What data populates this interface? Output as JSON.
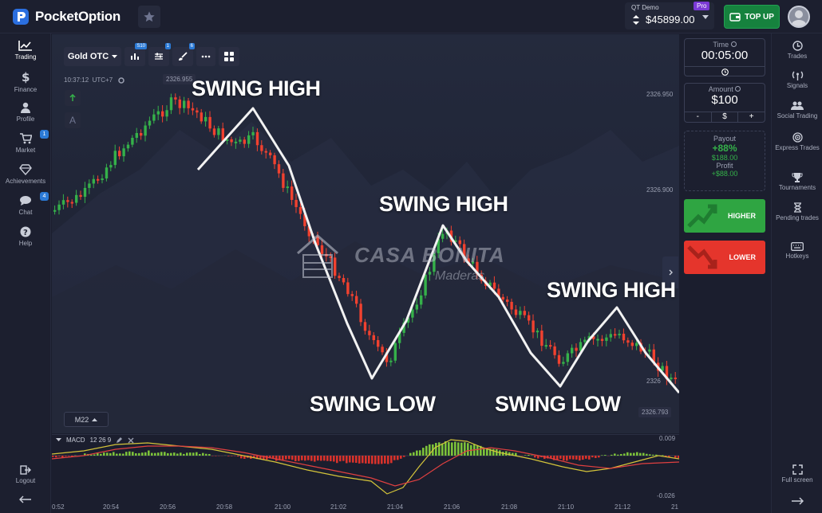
{
  "brand": {
    "name": "PocketOption"
  },
  "account": {
    "mode_label": "QT Demo",
    "pro_badge": "Pro",
    "balance": "$45899.00",
    "topup_label": "TOP UP"
  },
  "left_nav": [
    {
      "label": "Trading",
      "icon": "chart-line-icon"
    },
    {
      "label": "Finance",
      "icon": "dollar-icon"
    },
    {
      "label": "Profile",
      "icon": "user-icon"
    },
    {
      "label": "Market",
      "icon": "cart-icon",
      "badge": "1"
    },
    {
      "label": "Achievements",
      "icon": "diamond-icon"
    },
    {
      "label": "Chat",
      "icon": "chat-icon",
      "badge": "4"
    },
    {
      "label": "Help",
      "icon": "help-icon"
    }
  ],
  "logout_label": "Logout",
  "toolbar": {
    "asset": "Gold OTC",
    "timeframe_badge": "S10",
    "indicators_badge": "1",
    "drawings_badge": "6"
  },
  "chart_info": {
    "time": "10:37:12",
    "timezone": "UTC+7"
  },
  "price_axis": {
    "p1": "2326.950",
    "p2": "2326.900",
    "current_top": "2326.955",
    "current_low": "2326.793",
    "p_partial": "2326"
  },
  "timeframe_select": "M22",
  "annotations": {
    "sh1": "SWING HIGH",
    "sh2": "SWING HIGH",
    "sh3": "SWING HIGH",
    "sl1": "SWING LOW",
    "sl2": "SWING LOW"
  },
  "watermark": {
    "title": "CASA BONITA",
    "subtitle": "Maderas"
  },
  "macd": {
    "label": "MACD",
    "params": "12 26 9",
    "top": "0.009",
    "bottom": "-0.026"
  },
  "x_axis": [
    "0:52",
    "20:54",
    "20:56",
    "20:58",
    "21:00",
    "21:02",
    "21:04",
    "21:06",
    "21:08",
    "21:10",
    "21:12",
    "21"
  ],
  "trade_panel": {
    "time_label": "Time",
    "time_value": "00:05:00",
    "amount_label": "Amount",
    "amount_value": "$100",
    "minus": "-",
    "currency": "$",
    "plus": "+",
    "payout_label": "Payout",
    "payout_pct": "+88%",
    "payout_amount": "$188.00",
    "profit_label": "Profit",
    "profit_value": "+$88.00",
    "higher_label": "HIGHER",
    "lower_label": "LOWER"
  },
  "right_nav": [
    {
      "label": "Trades",
      "icon": "trades-icon"
    },
    {
      "label": "Signals",
      "icon": "signals-icon"
    },
    {
      "label": "Social Trading",
      "icon": "social-icon"
    },
    {
      "label": "Express Trades",
      "icon": "target-icon"
    },
    {
      "label": "Tournaments",
      "icon": "trophy-icon"
    },
    {
      "label": "Pending trades",
      "icon": "hourglass-icon"
    },
    {
      "label": "Hotkeys",
      "icon": "keyboard-icon"
    }
  ],
  "fullscreen_label": "Full screen",
  "colors": {
    "up": "#35b14a",
    "down": "#f1412f",
    "accent": "#2b7ad6",
    "higher": "#2fa542",
    "lower": "#e5352c"
  }
}
